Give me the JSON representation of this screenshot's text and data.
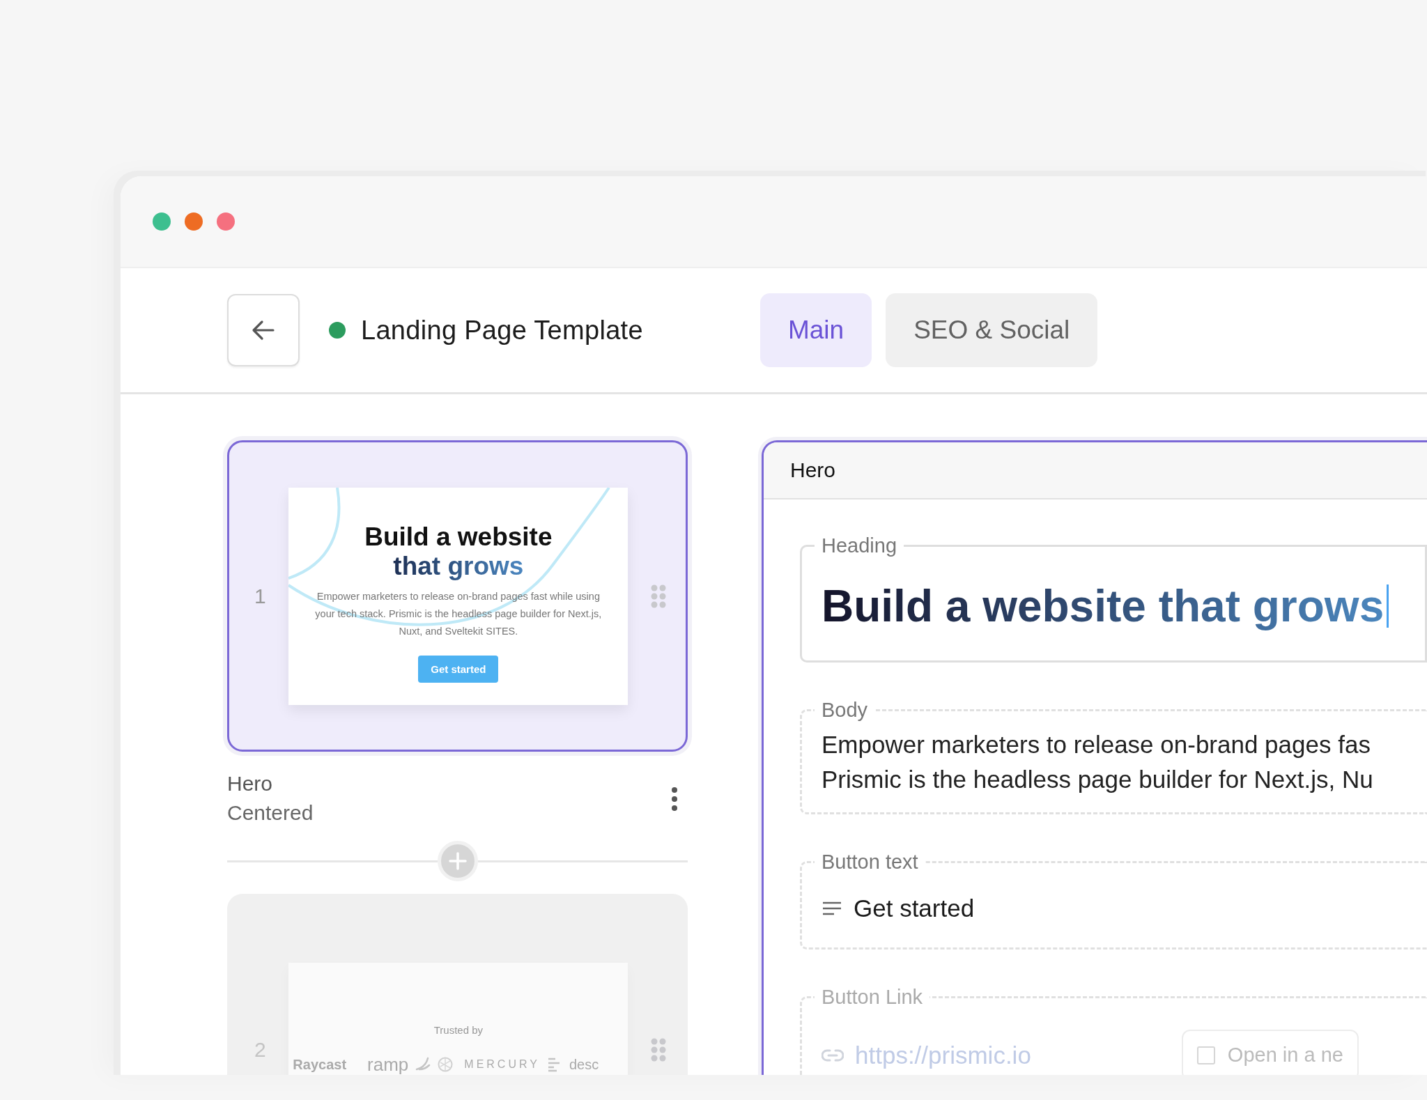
{
  "window": {
    "controls": [
      {
        "color": "#3dbf8f"
      },
      {
        "color": "#ee6c23"
      },
      {
        "color": "#f5707f"
      }
    ]
  },
  "header": {
    "status": {
      "color": "#2c9c5e"
    },
    "title": "Landing Page Template"
  },
  "tabs": [
    {
      "label": "Main",
      "selected": true
    },
    {
      "label": "SEO & Social",
      "selected": false
    }
  ],
  "slices": [
    {
      "number": "1",
      "selected": true,
      "name": "Hero",
      "variation": "Centered",
      "preview": {
        "kind": "hero",
        "heading_lines": [
          "Build a website",
          "that grows"
        ],
        "body": "Empower marketers to release on-brand pages fast while using your tech stack. Prismic is the headless page builder for Next.js, Nuxt, and Sveltekit SITES.",
        "button": "Get started"
      }
    },
    {
      "number": "2",
      "selected": false,
      "preview": {
        "kind": "logos",
        "caption": "Trusted by",
        "logos": [
          {
            "kind": "raycast",
            "name": "Raycast"
          },
          {
            "kind": "ramp",
            "name": "ramp"
          },
          {
            "kind": "mercury",
            "name": "MERCURY"
          },
          {
            "kind": "descript",
            "name": "desc"
          }
        ]
      }
    }
  ],
  "editor": {
    "title": "Hero",
    "fields": [
      {
        "kind": "heading",
        "label": "Heading",
        "focused": true,
        "value": "Build a website that grows"
      },
      {
        "kind": "rich",
        "label": "Body",
        "focused": false,
        "lines": [
          "Empower marketers to release on-brand pages fas",
          "Prismic is the headless page builder for Next.js, Nu"
        ]
      },
      {
        "kind": "text",
        "label": "Button text",
        "focused": false,
        "value": "Get started"
      },
      {
        "kind": "link",
        "label": "Button Link",
        "focused": false,
        "value": "https://prismic.io",
        "option": {
          "label": "Open in a ne",
          "checked": false
        }
      }
    ]
  }
}
